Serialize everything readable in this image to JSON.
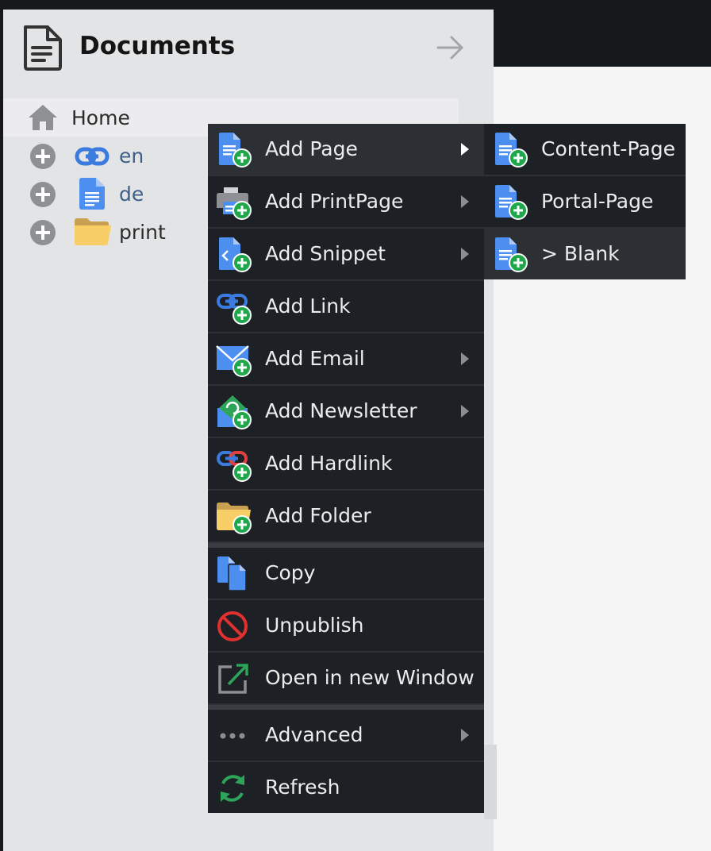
{
  "panel": {
    "title": "Documents",
    "icons": {
      "title": "document-icon",
      "collapse": "arrow-right-icon"
    }
  },
  "tree": {
    "home": {
      "label": "Home",
      "icon": "home-icon"
    },
    "items": [
      {
        "label": "en",
        "icon": "link-icon"
      },
      {
        "label": "de",
        "icon": "page-icon"
      },
      {
        "label": "print",
        "icon": "folder-icon"
      }
    ]
  },
  "menu": {
    "items": [
      {
        "label": "Add Page",
        "icon": "add-page-icon",
        "has_submenu": true,
        "active": true
      },
      {
        "label": "Add PrintPage",
        "icon": "add-printpage-icon",
        "has_submenu": true
      },
      {
        "label": "Add Snippet",
        "icon": "add-snippet-icon",
        "has_submenu": true
      },
      {
        "label": "Add Link",
        "icon": "add-link-icon",
        "has_submenu": false
      },
      {
        "label": "Add Email",
        "icon": "add-email-icon",
        "has_submenu": true
      },
      {
        "label": "Add Newsletter",
        "icon": "add-newsletter-icon",
        "has_submenu": true
      },
      {
        "label": "Add Hardlink",
        "icon": "add-hardlink-icon",
        "has_submenu": false
      },
      {
        "label": "Add Folder",
        "icon": "add-folder-icon",
        "has_submenu": false
      },
      {
        "label": "Copy",
        "icon": "copy-icon",
        "has_submenu": false
      },
      {
        "label": "Unpublish",
        "icon": "unpublish-icon",
        "has_submenu": false
      },
      {
        "label": "Open in new Window",
        "icon": "open-window-icon",
        "has_submenu": false
      },
      {
        "label": "Advanced",
        "icon": "more-icon",
        "has_submenu": true
      },
      {
        "label": "Refresh",
        "icon": "refresh-icon",
        "has_submenu": false
      }
    ]
  },
  "submenu": {
    "items": [
      {
        "label": "Content-Page",
        "icon": "add-page-icon"
      },
      {
        "label": "Portal-Page",
        "icon": "add-page-icon"
      },
      {
        "label": "> Blank",
        "icon": "add-page-icon",
        "active": true
      }
    ]
  },
  "colors": {
    "menu_bg": "#1d2024",
    "menu_active": "#2c2f33",
    "panel_bg": "#e3e4e6",
    "top_bar": "#15191c",
    "page_blue": "#4d8ff0",
    "plus_green": "#1fa84b",
    "folder_yellow": "#f2c75a"
  }
}
